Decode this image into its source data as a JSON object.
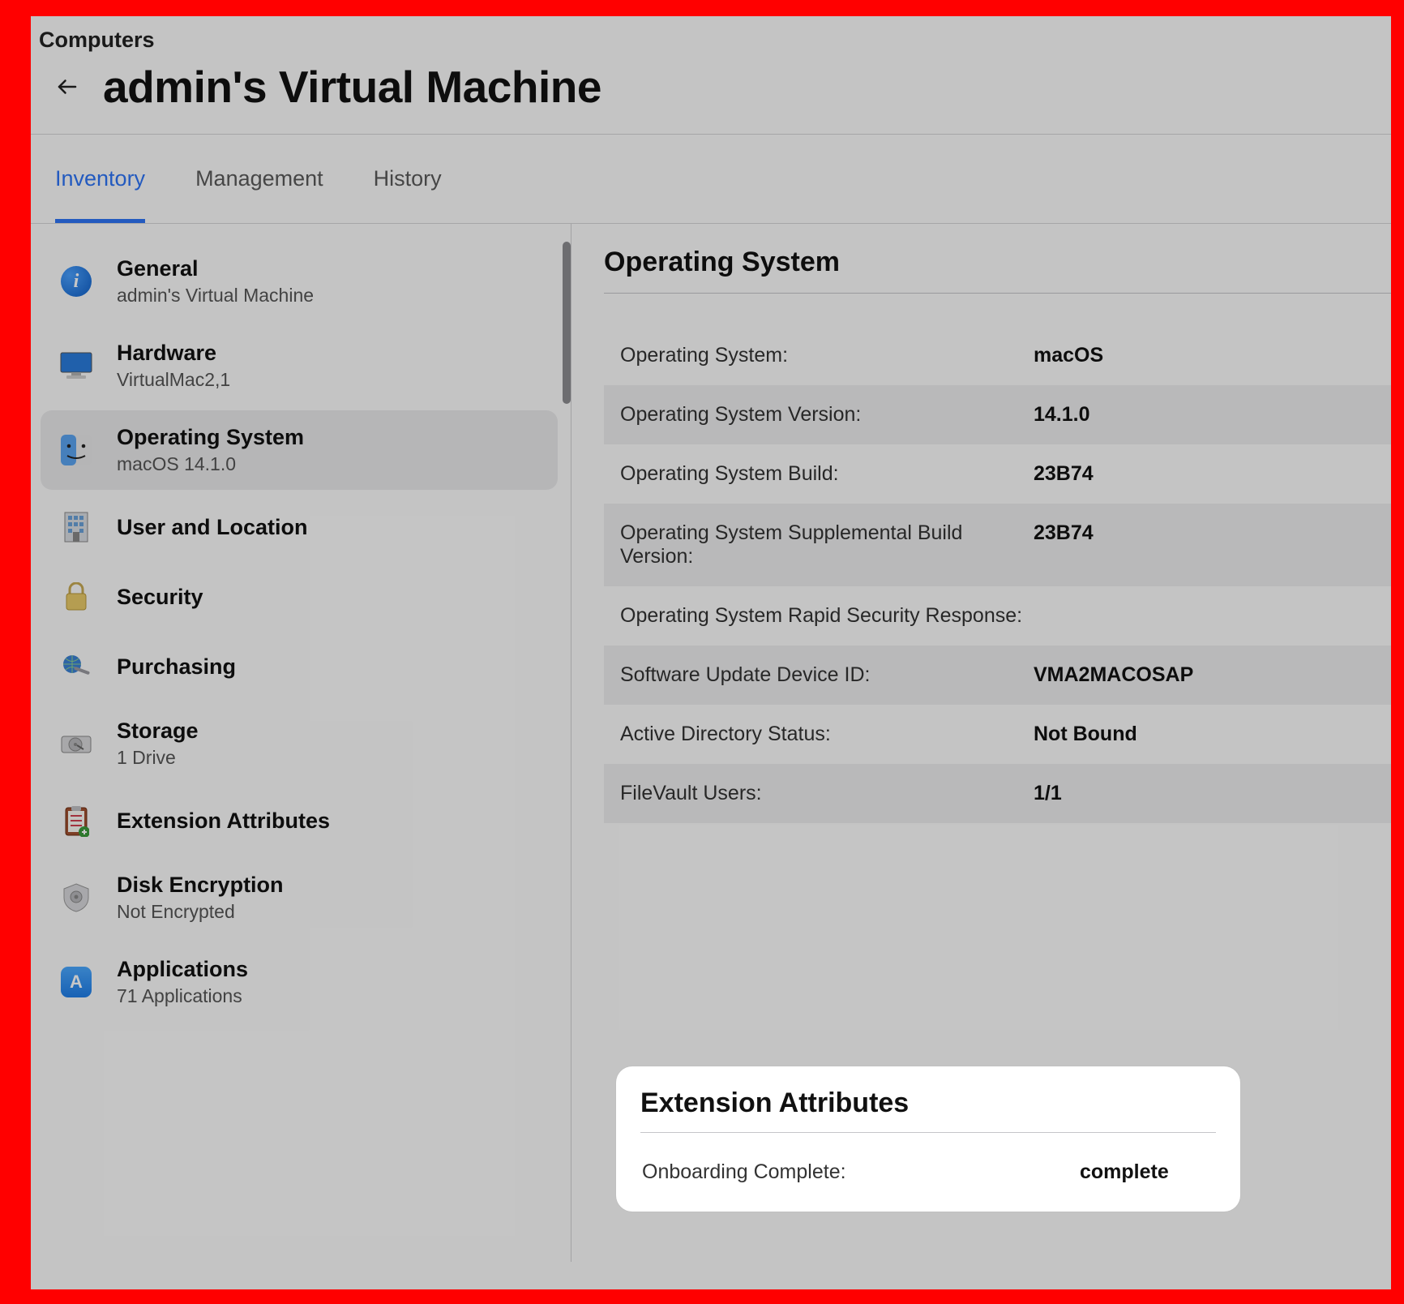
{
  "header": {
    "breadcrumb": "Computers",
    "title": "admin's Virtual Machine"
  },
  "tabs": {
    "items": [
      {
        "label": "Inventory",
        "active": true
      },
      {
        "label": "Management",
        "active": false
      },
      {
        "label": "History",
        "active": false
      }
    ]
  },
  "sidebar": {
    "items": [
      {
        "icon": "info-icon",
        "label": "General",
        "sub": "admin's Virtual Machine",
        "selected": false
      },
      {
        "icon": "monitor-icon",
        "label": "Hardware",
        "sub": "VirtualMac2,1",
        "selected": false
      },
      {
        "icon": "finder-icon",
        "label": "Operating System",
        "sub": "macOS 14.1.0",
        "selected": true
      },
      {
        "icon": "building-icon",
        "label": "User and Location",
        "sub": "",
        "selected": false
      },
      {
        "icon": "lock-icon",
        "label": "Security",
        "sub": "",
        "selected": false
      },
      {
        "icon": "globe-wrench-icon",
        "label": "Purchasing",
        "sub": "",
        "selected": false
      },
      {
        "icon": "hdd-icon",
        "label": "Storage",
        "sub": "1 Drive",
        "selected": false
      },
      {
        "icon": "clipboard-icon",
        "label": "Extension Attributes",
        "sub": "",
        "selected": false
      },
      {
        "icon": "vault-icon",
        "label": "Disk Encryption",
        "sub": "Not Encrypted",
        "selected": false
      },
      {
        "icon": "app-icon",
        "label": "Applications",
        "sub": "71 Applications",
        "selected": false
      }
    ]
  },
  "content": {
    "section_title": "Operating System",
    "rows": [
      {
        "label": "Operating System:",
        "value": "macOS",
        "alt": false
      },
      {
        "label": "Operating System Version:",
        "value": "14.1.0",
        "alt": true
      },
      {
        "label": "Operating System Build:",
        "value": "23B74",
        "alt": false
      },
      {
        "label": "Operating System Supplemental Build Version:",
        "value": "23B74",
        "alt": true
      },
      {
        "label": "Operating System Rapid Security Response:",
        "value": "",
        "alt": false
      },
      {
        "label": "Software Update Device ID:",
        "value": "VMA2MACOSAP",
        "alt": true
      },
      {
        "label": "Active Directory Status:",
        "value": "Not Bound",
        "alt": false
      },
      {
        "label": "FileVault Users:",
        "value": "1/1",
        "alt": true
      }
    ]
  },
  "highlight": {
    "title": "Extension Attributes",
    "rows": [
      {
        "label": "Onboarding Complete:",
        "value": "complete"
      }
    ]
  }
}
